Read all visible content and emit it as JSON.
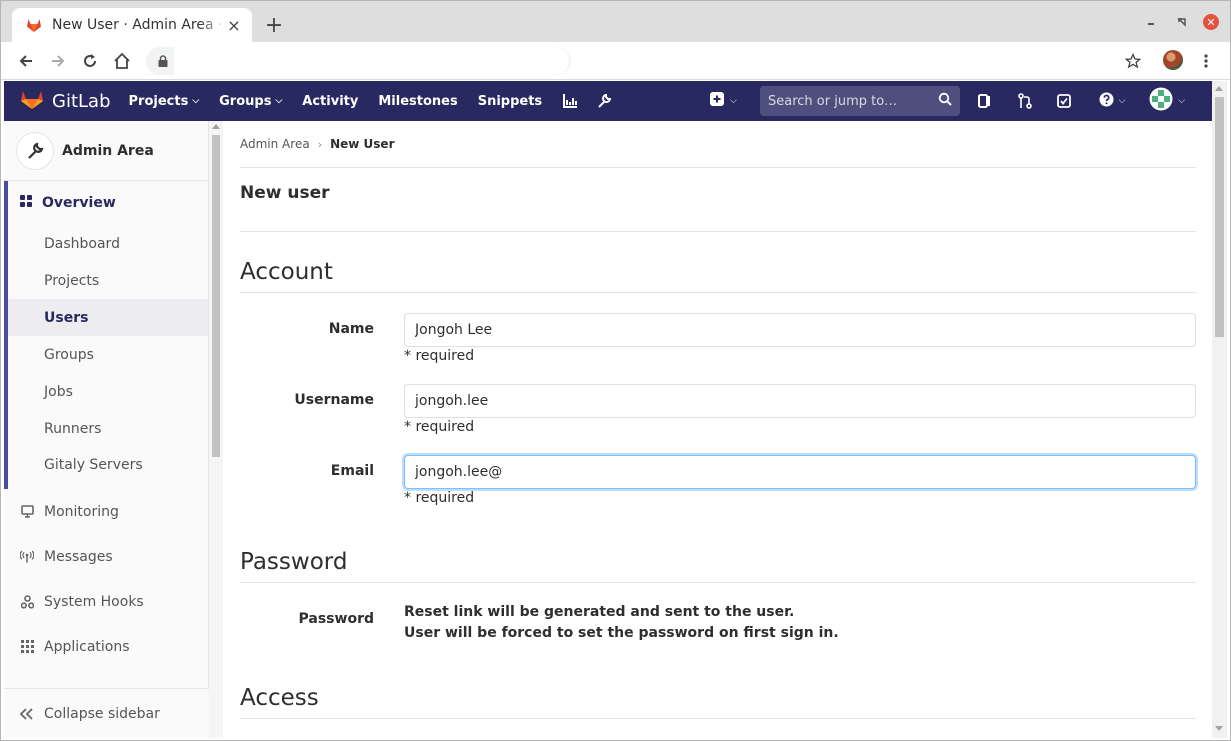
{
  "browser": {
    "tab_title": "New User · Admin Area · GitLab",
    "new_tab_label": "+",
    "address_value": ""
  },
  "header": {
    "logo_text": "GitLab",
    "nav": [
      {
        "label": "Projects",
        "has_caret": true
      },
      {
        "label": "Groups",
        "has_caret": true
      },
      {
        "label": "Activity",
        "has_caret": false
      },
      {
        "label": "Milestones",
        "has_caret": false
      },
      {
        "label": "Snippets",
        "has_caret": false
      }
    ],
    "search_placeholder": "Search or jump to…",
    "colors": {
      "header_bg": "#292961",
      "accent": "#4b4ba3"
    }
  },
  "sidebar": {
    "context_title": "Admin Area",
    "overview": {
      "label": "Overview",
      "items": [
        "Dashboard",
        "Projects",
        "Users",
        "Groups",
        "Jobs",
        "Runners",
        "Gitaly Servers"
      ],
      "active_item": "Users"
    },
    "items": [
      "Monitoring",
      "Messages",
      "System Hooks",
      "Applications"
    ],
    "collapse_label": "Collapse sidebar"
  },
  "breadcrumb": {
    "parent": "Admin Area",
    "current": "New User"
  },
  "page": {
    "title": "New user",
    "account": {
      "heading": "Account",
      "name_label": "Name",
      "name_value": "Jongoh Lee",
      "username_label": "Username",
      "username_value": "jongoh.lee",
      "email_label": "Email",
      "email_value": "jongoh.lee@",
      "required_text": "* required"
    },
    "password": {
      "heading": "Password",
      "label": "Password",
      "line1": "Reset link will be generated and sent to the user.",
      "line2": "User will be forced to set the password on first sign in."
    },
    "access": {
      "heading": "Access"
    }
  }
}
